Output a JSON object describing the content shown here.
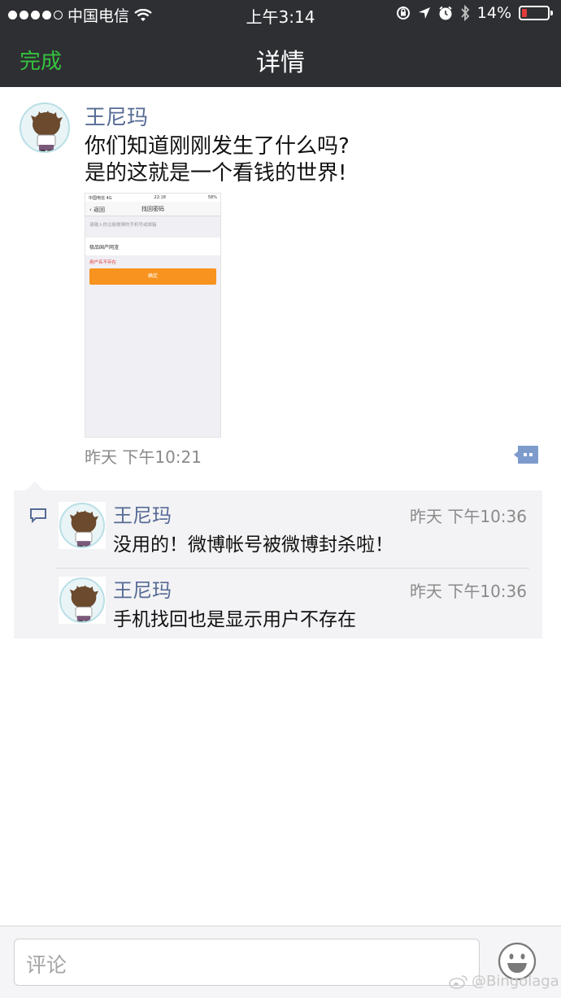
{
  "status_bar": {
    "carrier": "中国电信",
    "time": "上午3:14",
    "battery": "14%",
    "signal_icon": "signal-dots-icon",
    "wifi_icon": "wifi-icon",
    "battery_color": "#e23b3b"
  },
  "nav": {
    "done_label": "完成",
    "title": "详情",
    "done_color": "#35c33f"
  },
  "post": {
    "author": "王尼玛",
    "text_line1": "你们知道刚刚发生了什么吗?",
    "text_line2": "是的这就是一个看钱的世界!",
    "time": "昨天 下午10:21",
    "image": {
      "status_carrier": "中国电信 4G",
      "status_time": "22:18",
      "status_battery": "58%",
      "back_label": "返回",
      "title": "找回密码",
      "input_placeholder": "请输入你注册微博的手机号或邮箱",
      "account_value": "极品国产网渣",
      "error_text": "用户名不存在",
      "confirm_label": "确定",
      "button_color": "#f7931e"
    }
  },
  "comments": [
    {
      "author": "王尼玛",
      "time": "昨天 下午10:36",
      "text": "没用的！微博帐号被微博封杀啦！"
    },
    {
      "author": "王尼玛",
      "time": "昨天 下午10:36",
      "text": "手机找回也是显示用户不存在"
    }
  ],
  "bottom": {
    "comment_placeholder": "评论",
    "emoji_icon": "smiley-face-icon",
    "watermark": "@Bingolaga"
  },
  "colors": {
    "name_link": "#576b95",
    "nav_bg": "#2e2f33",
    "comment_bg": "#f3f3f5"
  }
}
